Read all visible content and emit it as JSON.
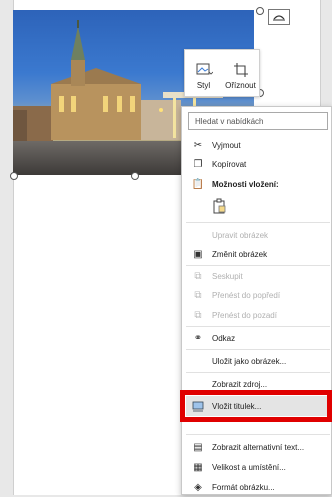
{
  "menu": {
    "search_placeholder": "Hledat v nabídkách",
    "items": [
      {
        "label": "Vyjmout",
        "icon": "scissors-icon",
        "enabled": true
      },
      {
        "label": "Kopírovat",
        "icon": "copy-icon",
        "enabled": true
      },
      {
        "label": "Možnosti vložení:",
        "icon": "paste-icon",
        "enabled": true,
        "bold": true
      },
      {
        "label": "Upravit obrázek",
        "enabled": false
      },
      {
        "label": "Změnit obrázek",
        "icon": "change-picture-icon",
        "enabled": true
      },
      {
        "label": "Seskupit",
        "icon": "group-icon",
        "enabled": false
      },
      {
        "label": "Přenést do popředí",
        "icon": "bring-forward-icon",
        "enabled": false
      },
      {
        "label": "Přenést do pozadí",
        "icon": "send-backward-icon",
        "enabled": false
      },
      {
        "label": "Odkaz",
        "icon": "link-icon",
        "enabled": true
      },
      {
        "label": "Uložit jako obrázek...",
        "enabled": true
      },
      {
        "label": "Zobrazit zdroj...",
        "enabled": true
      },
      {
        "label": "Vložit titulek...",
        "icon": "caption-icon",
        "enabled": true,
        "highlighted": true
      },
      {
        "label": "Zobrazit alternativní text...",
        "icon": "alt-text-icon",
        "enabled": true
      },
      {
        "label": "Velikost a umístění...",
        "icon": "size-position-icon",
        "enabled": true
      },
      {
        "label": "Formát obrázku...",
        "icon": "format-picture-icon",
        "enabled": true
      }
    ]
  },
  "minitoolbar": {
    "style_label": "Styl",
    "crop_label": "Oříznout"
  },
  "colors": {
    "highlight": "#e00000"
  }
}
